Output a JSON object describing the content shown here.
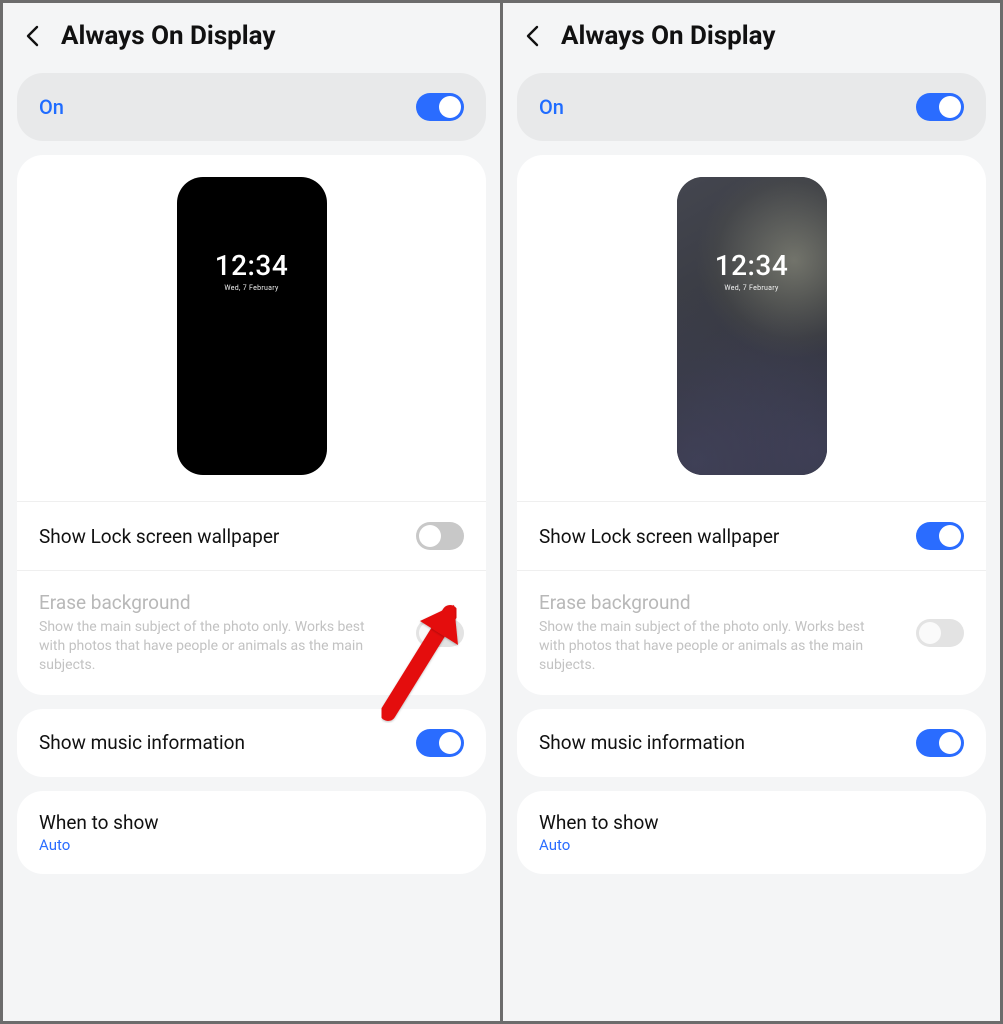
{
  "header": {
    "title": "Always On Display"
  },
  "master_toggle": {
    "label": "On"
  },
  "preview": {
    "time": "12:34",
    "date": "Wed, 7 February"
  },
  "rows": {
    "show_wallpaper": {
      "title": "Show Lock screen wallpaper"
    },
    "erase_bg": {
      "title": "Erase background",
      "subtitle": "Show the main subject of the photo only. Works best with photos that have people or animals as the main subjects."
    },
    "music": {
      "title": "Show music information"
    },
    "when_to_show": {
      "title": "When to show",
      "value": "Auto"
    }
  }
}
